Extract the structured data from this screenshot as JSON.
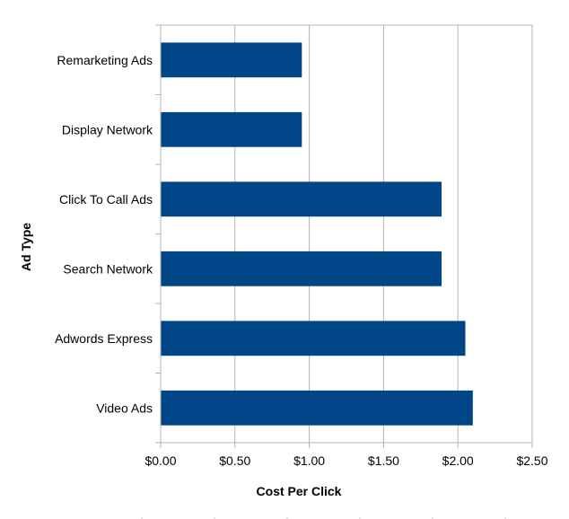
{
  "chart_data": {
    "type": "bar",
    "orientation": "horizontal",
    "title": "",
    "xlabel": "Cost Per Click",
    "ylabel": "Ad Type",
    "categories": [
      "Remarketing Ads",
      "Display Network",
      "Click To Call Ads",
      "Search Network",
      "Adwords Express",
      "Video Ads"
    ],
    "values": [
      0.95,
      0.95,
      1.89,
      1.89,
      2.05,
      2.1
    ],
    "xlim": [
      0,
      2.5
    ],
    "xticks": [
      0,
      0.5,
      1.0,
      1.5,
      2.0,
      2.5
    ],
    "xtick_labels": [
      "$0.00",
      "$0.50",
      "$1.00",
      "$1.50",
      "$2.00",
      "$2.50"
    ],
    "grid": "vertical",
    "legend": "none",
    "bar_color": "#004586",
    "grid_color": "#b3b3b3"
  }
}
